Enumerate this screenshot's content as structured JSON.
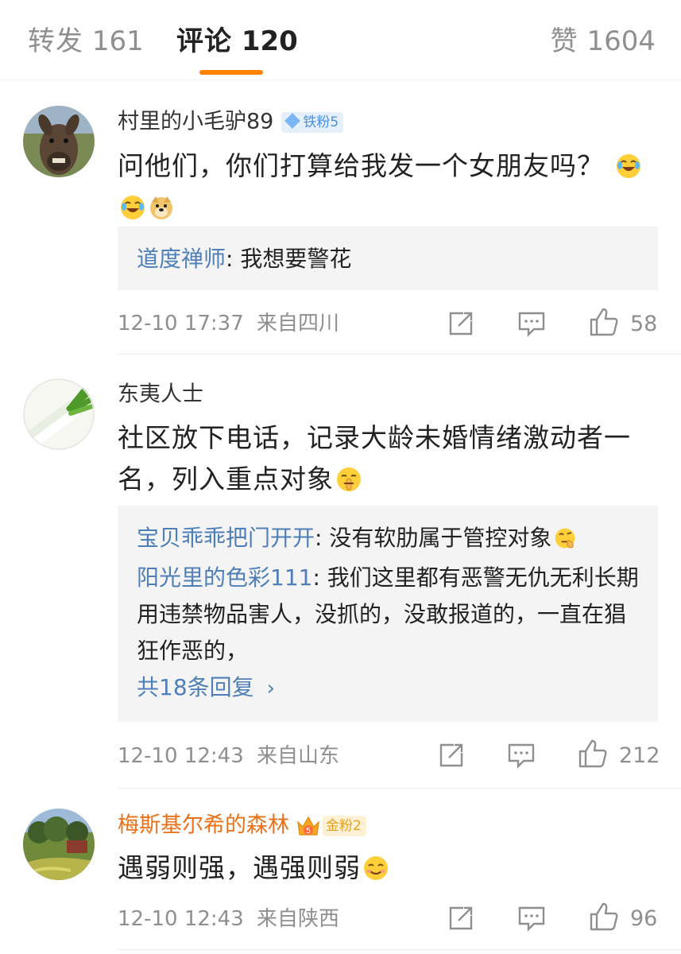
{
  "tabs": {
    "repost": {
      "label": "转发",
      "count": "161"
    },
    "comment": {
      "label": "评论",
      "count": "120"
    },
    "like": {
      "label": "赞",
      "count": "1604"
    }
  },
  "colors": {
    "accent": "#ff8200",
    "link": "#4f7fb8",
    "gold_user": "#e8711a",
    "muted": "#8f8f8f"
  },
  "comments": [
    {
      "username": "村里的小毛驴89",
      "badge": "铁粉5",
      "text": "问他们，你们打算给我发一个女朋友吗？",
      "emojis": [
        "laugh-cry-emoji",
        "laugh-cry-emoji",
        "doge-emoji"
      ],
      "replies": [
        {
          "user": "道度禅师",
          "text": ": 我想要警花"
        }
      ],
      "time": "12-10 17:37",
      "location": "来自四川",
      "likes": "58"
    },
    {
      "username": "东夷人士",
      "text": "社区放下电话，记录大龄未婚情绪激动者一名，列入重点对象",
      "emojis": [
        "shush-emoji"
      ],
      "replies": [
        {
          "user": "宝贝乖乖把门开开",
          "text": ": 没有软肋属于管控对象"
        },
        {
          "user": "阳光里的色彩111",
          "text": ": 我们这里都有恶警无仇无利长期用违禁物品害人，没抓的，没敢报道的，一直在猖狂作恶的，"
        }
      ],
      "more_replies": "共18条回复",
      "time": "12-10 12:43",
      "location": "来自山东",
      "likes": "212"
    },
    {
      "username": "梅斯基尔希的森林",
      "badge": "金粉2",
      "crown_level": "5",
      "text": "遇弱则强，遇强则弱",
      "emojis": [
        "smile-emoji"
      ],
      "time": "12-10 12:43",
      "location": "来自陕西",
      "likes": "96"
    }
  ]
}
